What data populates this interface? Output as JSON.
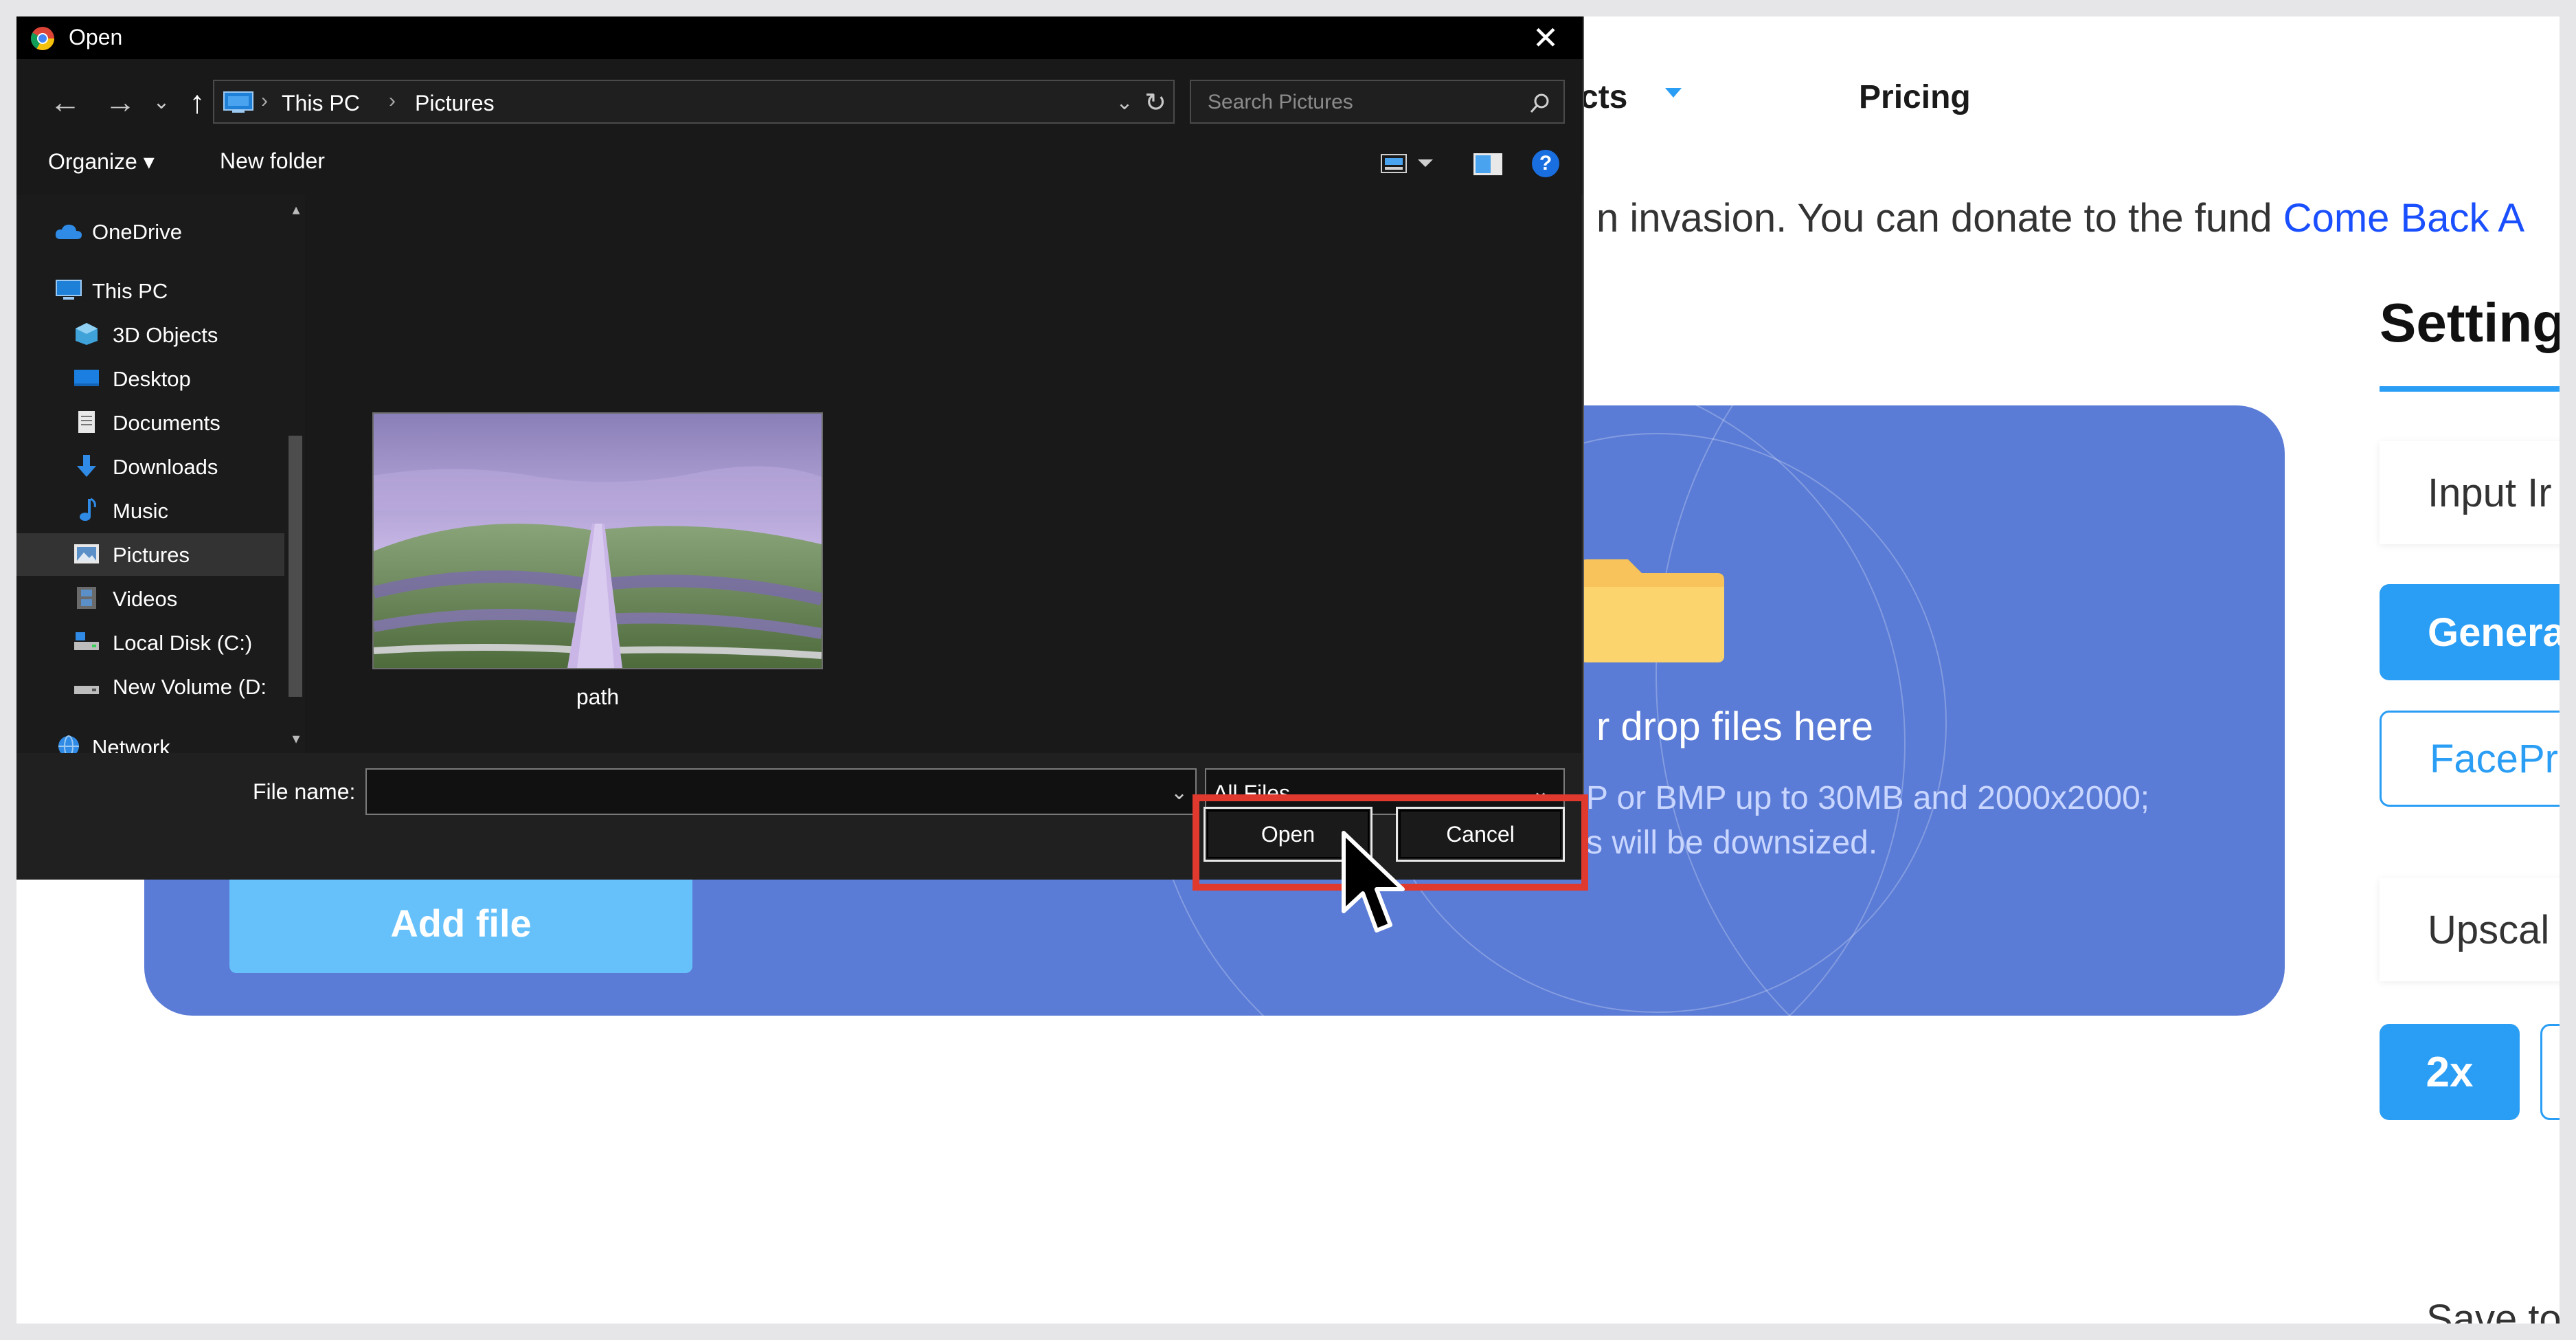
{
  "background_page": {
    "nav": {
      "products_partial": "cts",
      "pricing": "Pricing"
    },
    "notice": {
      "text": "n invasion. You can donate to the fund ",
      "link": "Come Back A"
    },
    "dropzone": {
      "drop_text": "r drop files here",
      "formats_line1": "P or BMP up to 30MB and 2000x2000;",
      "formats_line2": "s will be downsized.",
      "add_file_label": "Add file"
    },
    "settings": {
      "title": "Setting",
      "input_label": "Input Ir",
      "generate_label": "Genera",
      "faceproc_label": "FacePr",
      "upscale_label": "Upscal",
      "scale_2x": "2x",
      "save_to_label": "Save to"
    },
    "colors": {
      "accent": "#2a9df4",
      "hero": "#5a7bd6",
      "add_file": "#66c1fb"
    }
  },
  "dialog": {
    "title": "Open",
    "close_label": "✕",
    "nav": {
      "back": "←",
      "forward": "→",
      "recent": "⌄",
      "up": "↑",
      "refresh": "↻",
      "dropdown": "⌄"
    },
    "breadcrumb": {
      "this_pc": "This PC",
      "pictures": "Pictures",
      "sep": "›"
    },
    "search_placeholder": "Search Pictures",
    "toolbar": {
      "organize": "Organize ▾",
      "new_folder": "New folder",
      "help": "?"
    },
    "sidebar": {
      "onedrive": "OneDrive",
      "this_pc": "This PC",
      "objects_3d": "3D Objects",
      "desktop": "Desktop",
      "documents": "Documents",
      "downloads": "Downloads",
      "music": "Music",
      "pictures": "Pictures",
      "videos": "Videos",
      "local_disk": "Local Disk (C:)",
      "new_volume": "New Volume (D:",
      "network": "Network"
    },
    "file": {
      "name": "path"
    },
    "file_name_label": "File name:",
    "file_name_value": "",
    "filter_value": "All Files",
    "caret": "⌄",
    "open_label": "Open",
    "cancel_label": "Cancel",
    "colors": {
      "highlight": "#e03a2e",
      "background": "#202020"
    }
  }
}
